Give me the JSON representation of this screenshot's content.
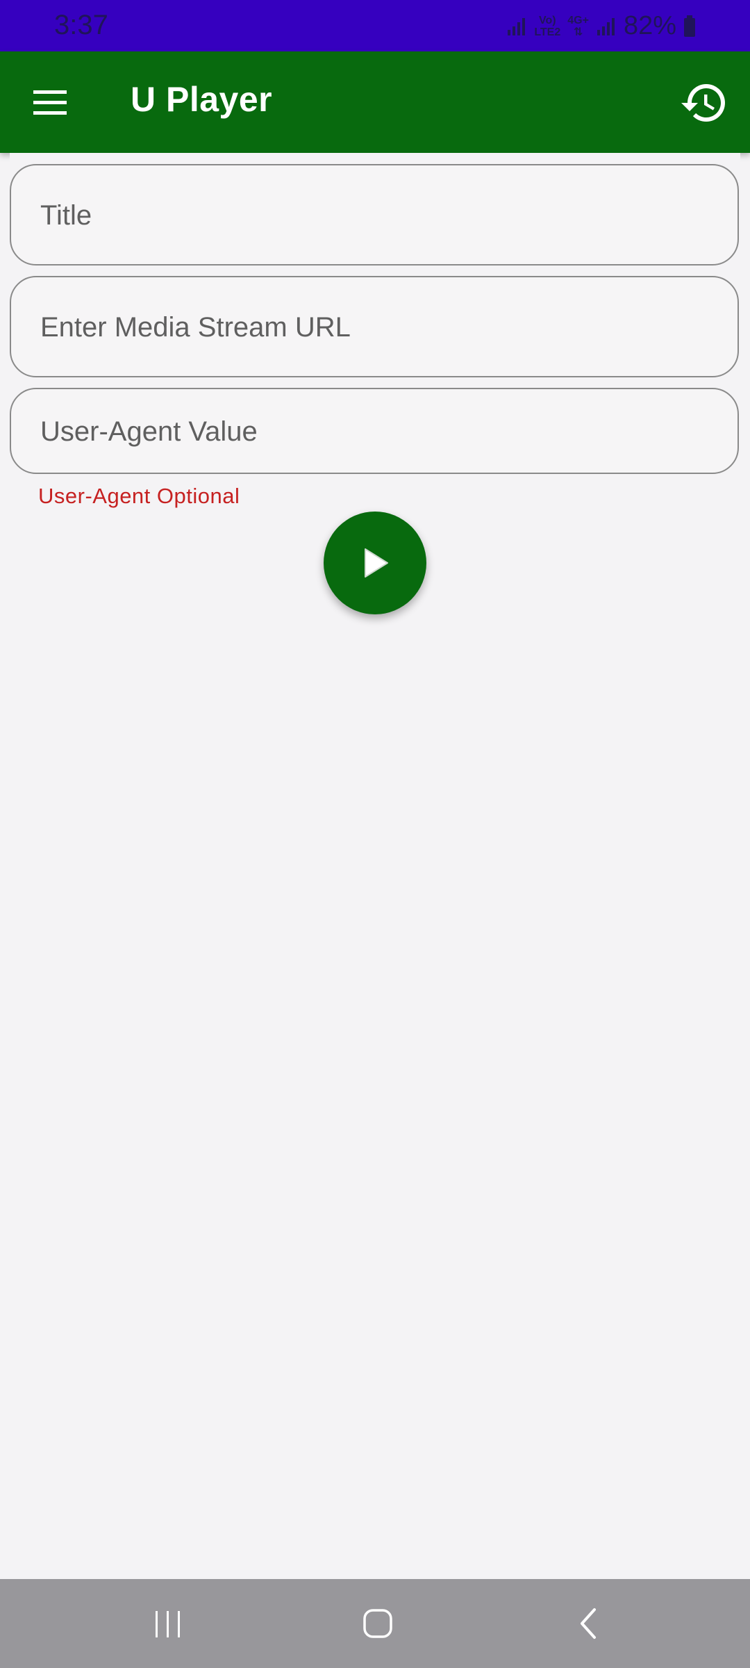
{
  "status_bar": {
    "time": "3:37",
    "network_top": "Vo)",
    "network_bottom": "LTE2",
    "network_type": "4G+",
    "battery": "82%"
  },
  "app_bar": {
    "title": "U Player",
    "menu_icon": "menu-icon",
    "history_icon": "history-icon"
  },
  "form": {
    "title_placeholder": "Title",
    "url_placeholder": "Enter Media Stream URL",
    "user_agent_placeholder": "User-Agent Value",
    "user_agent_hint": "User-Agent Optional",
    "play_icon": "play-icon"
  },
  "nav_bar": {
    "recents_icon": "recents-icon",
    "home_icon": "home-icon",
    "back_icon": "back-icon"
  },
  "colors": {
    "status_bar": "#3600bf",
    "app_bar": "#086a0e",
    "hint": "#c62121",
    "nav_bar": "#98979b"
  }
}
